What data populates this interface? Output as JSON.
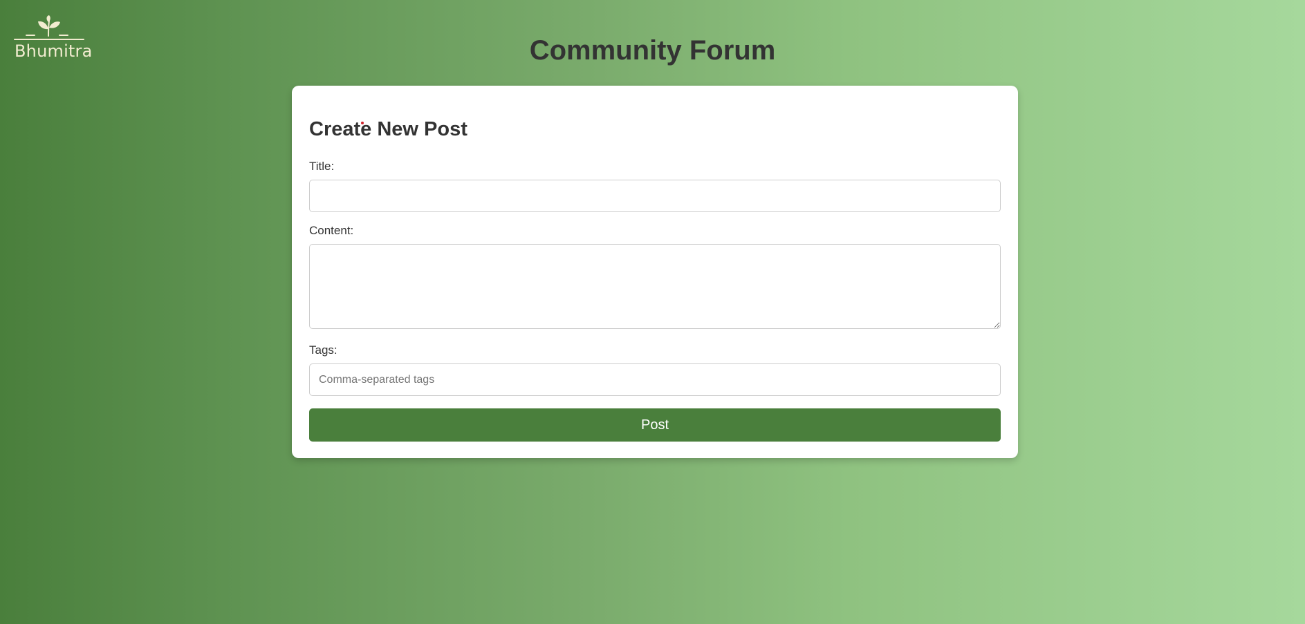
{
  "brand": {
    "logo_text": "Bhumitra",
    "logo_icon": "sprout-icon",
    "logo_color": "#f2ecd0"
  },
  "header": {
    "title": "Community Forum"
  },
  "form": {
    "heading": "Create New Post",
    "title_label": "Title:",
    "title_value": "",
    "content_label": "Content:",
    "content_value": "",
    "tags_label": "Tags:",
    "tags_value": "",
    "tags_placeholder": "Comma-separated tags",
    "submit_label": "Post"
  },
  "colors": {
    "accent": "#4a7f3c",
    "background_start": "#4a7f3c",
    "background_end": "#a6d89c",
    "card": "#ffffff",
    "text": "#333333"
  }
}
